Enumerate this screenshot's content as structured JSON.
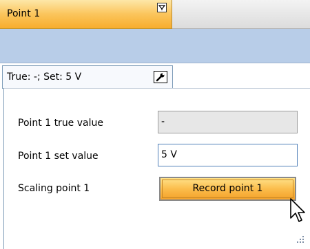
{
  "header": {
    "title": "Point 1",
    "filter_icon": "filter-icon"
  },
  "summary": {
    "text": "True: -; Set: 5 V",
    "tool_icon": "wrench-icon"
  },
  "form": {
    "true_value_label": "Point 1 true value",
    "true_value": "-",
    "set_value_label": "Point 1 set value",
    "set_value": "5 V",
    "scaling_label": "Scaling point 1",
    "record_button_label": "Record point 1"
  },
  "colors": {
    "accent_orange": "#fbc55c",
    "strip_blue": "#b8cde8",
    "border_blue": "#7f9db9"
  }
}
